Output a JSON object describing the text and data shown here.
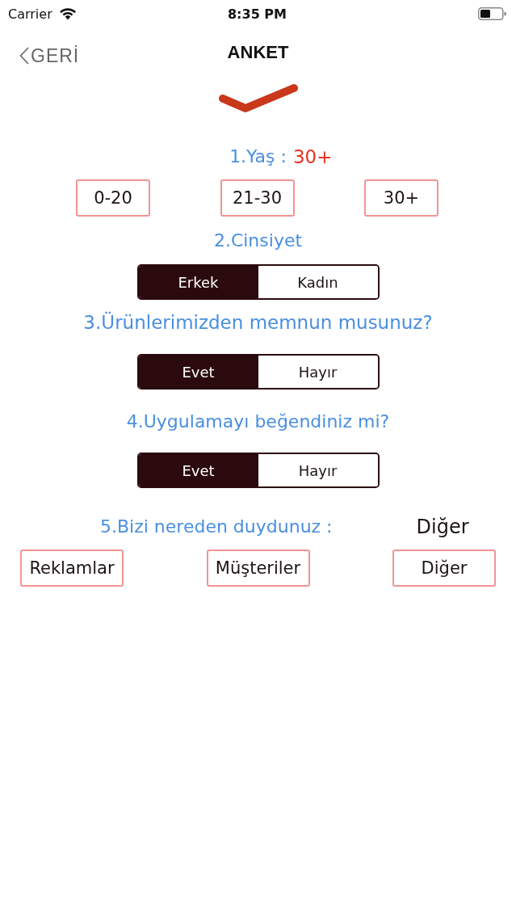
{
  "status_bar": {
    "carrier": "Carrier",
    "time": "8:35 PM"
  },
  "nav": {
    "back": "GERİ",
    "title": "ANKET"
  },
  "questions": [
    {
      "kind": "compact",
      "title": "1.Yaş :",
      "answer": "30+",
      "options": [
        "0-20",
        "21-30",
        "30+"
      ]
    },
    {
      "kind": "segmented",
      "title": "2.Cinsiyet",
      "segments": [
        {
          "label": "Erkek",
          "selected": true
        },
        {
          "label": "Kadın",
          "selected": false
        }
      ]
    },
    {
      "kind": "segmented",
      "title": "3.Ürünlerimizden memnun musunuz?",
      "segments": [
        {
          "label": "Evet",
          "selected": true
        },
        {
          "label": "Hayır",
          "selected": false
        }
      ]
    },
    {
      "kind": "segmented",
      "title": "4.Uygulamayı beğendiniz mi?",
      "segments": [
        {
          "label": "Evet",
          "selected": true
        },
        {
          "label": "Hayır",
          "selected": false
        }
      ]
    },
    {
      "kind": "wide",
      "title": "5.Bizi nereden duydunuz :",
      "answer": "Diğer",
      "options": [
        "Reklamlar",
        "Müşteriler",
        "Diğer"
      ]
    }
  ]
}
